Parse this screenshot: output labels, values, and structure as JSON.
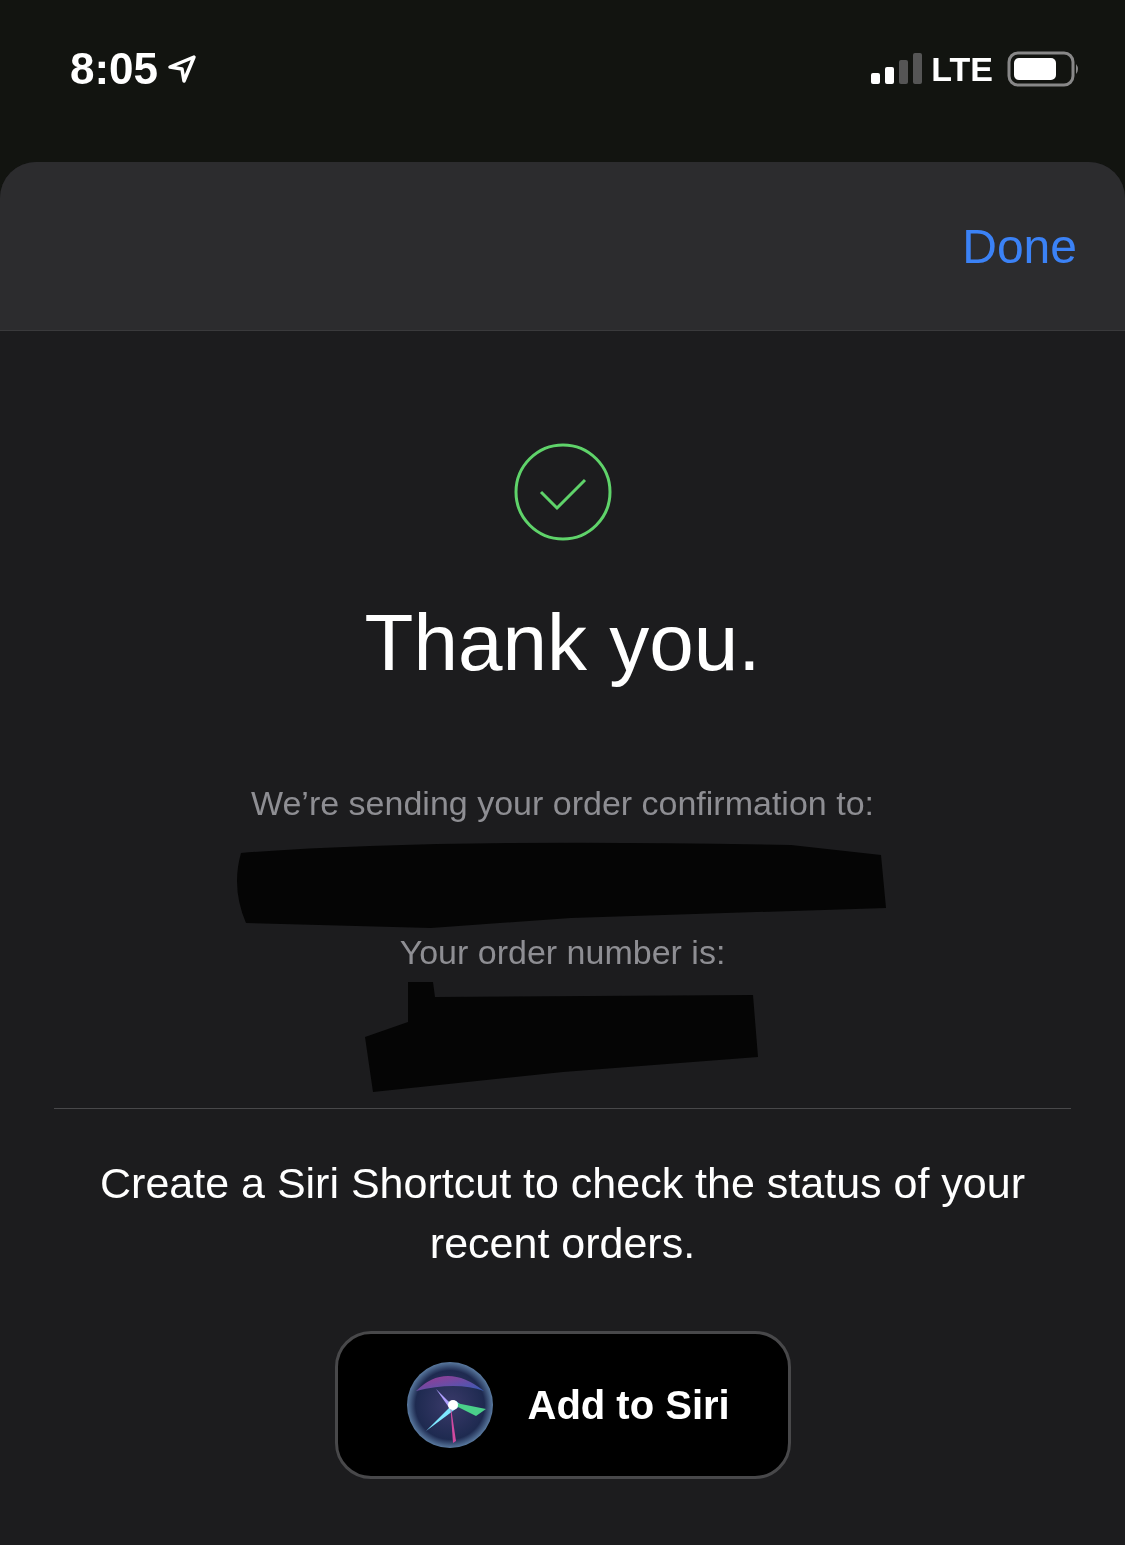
{
  "status_bar": {
    "time": "8:05",
    "network": "LTE"
  },
  "header": {
    "done_button": "Done"
  },
  "confirmation": {
    "title": "Thank you.",
    "email_label": "We’re sending your order confirmation to:",
    "order_label": "Your order number is:"
  },
  "siri": {
    "prompt": "Create a Siri Shortcut to check the status of your recent orders.",
    "button": "Add to Siri"
  }
}
